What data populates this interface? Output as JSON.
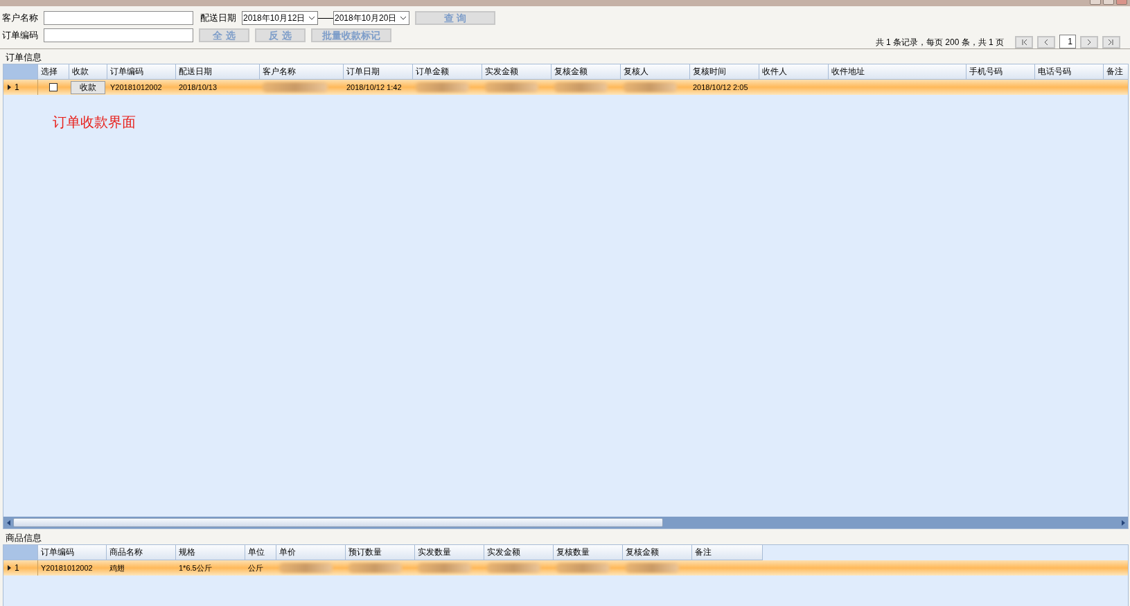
{
  "filters": {
    "customer_label": "客户名称",
    "order_label": "订单编码",
    "date_label": "配送日期",
    "date_from": "2018年10月12日",
    "date_to": "2018年10月20日"
  },
  "buttons": [
    {
      "label": "查 询",
      "disabled": true
    },
    {
      "label": "全 选",
      "disabled": true
    },
    {
      "label": "反 选",
      "disabled": true
    },
    {
      "label": "批量收款标记",
      "disabled": true
    }
  ],
  "pager": {
    "summary": "共 1 条记录，每页 200 条，共 1 页",
    "page": "1"
  },
  "orders": {
    "title": "订单信息",
    "columns": [
      "选择",
      "收款",
      "订单编码",
      "配送日期",
      "客户名称",
      "订单日期",
      "订单金额",
      "实发金额",
      "复核金额",
      "复核人",
      "复核时间",
      "收件人",
      "收件地址",
      "手机号码",
      "电话号码",
      "备注"
    ],
    "rows": [
      {
        "label": "1",
        "current": true,
        "selected": true,
        "cells": [
          {
            "kind": "checkbox",
            "checked": false
          },
          {
            "kind": "button",
            "text": "收款"
          },
          {
            "kind": "text",
            "text": "Y20181012002"
          },
          {
            "kind": "text",
            "text": "2018/10/13"
          },
          {
            "kind": "blurred"
          },
          {
            "kind": "text",
            "text": "2018/10/12 1:42"
          },
          {
            "kind": "blurred"
          },
          {
            "kind": "blurred"
          },
          {
            "kind": "blurred"
          },
          {
            "kind": "blurred"
          },
          {
            "kind": "text",
            "text": "2018/10/12 2:05"
          },
          {
            "kind": "blank"
          },
          {
            "kind": "blank"
          },
          {
            "kind": "blank"
          },
          {
            "kind": "blank"
          },
          {
            "kind": "blank"
          }
        ]
      }
    ]
  },
  "note": "订单收款界面",
  "goods": {
    "title": "商品信息",
    "columns": [
      "订单编码",
      "商品名称",
      "规格",
      "单位",
      "单价",
      "预订数量",
      "实发数量",
      "实发金额",
      "复核数量",
      "复核金额",
      "备注"
    ],
    "rows": [
      {
        "label": "1",
        "current": true,
        "selected": true,
        "cells": [
          {
            "kind": "text",
            "text": "Y20181012002"
          },
          {
            "kind": "text",
            "text": "鸡翅"
          },
          {
            "kind": "text",
            "text": "1*6.5公斤"
          },
          {
            "kind": "text",
            "text": "公斤"
          },
          {
            "kind": "blurred"
          },
          {
            "kind": "blurred"
          },
          {
            "kind": "blurred"
          },
          {
            "kind": "blurred"
          },
          {
            "kind": "blurred"
          },
          {
            "kind": "blurred"
          },
          {
            "kind": "blank"
          }
        ]
      }
    ]
  }
}
